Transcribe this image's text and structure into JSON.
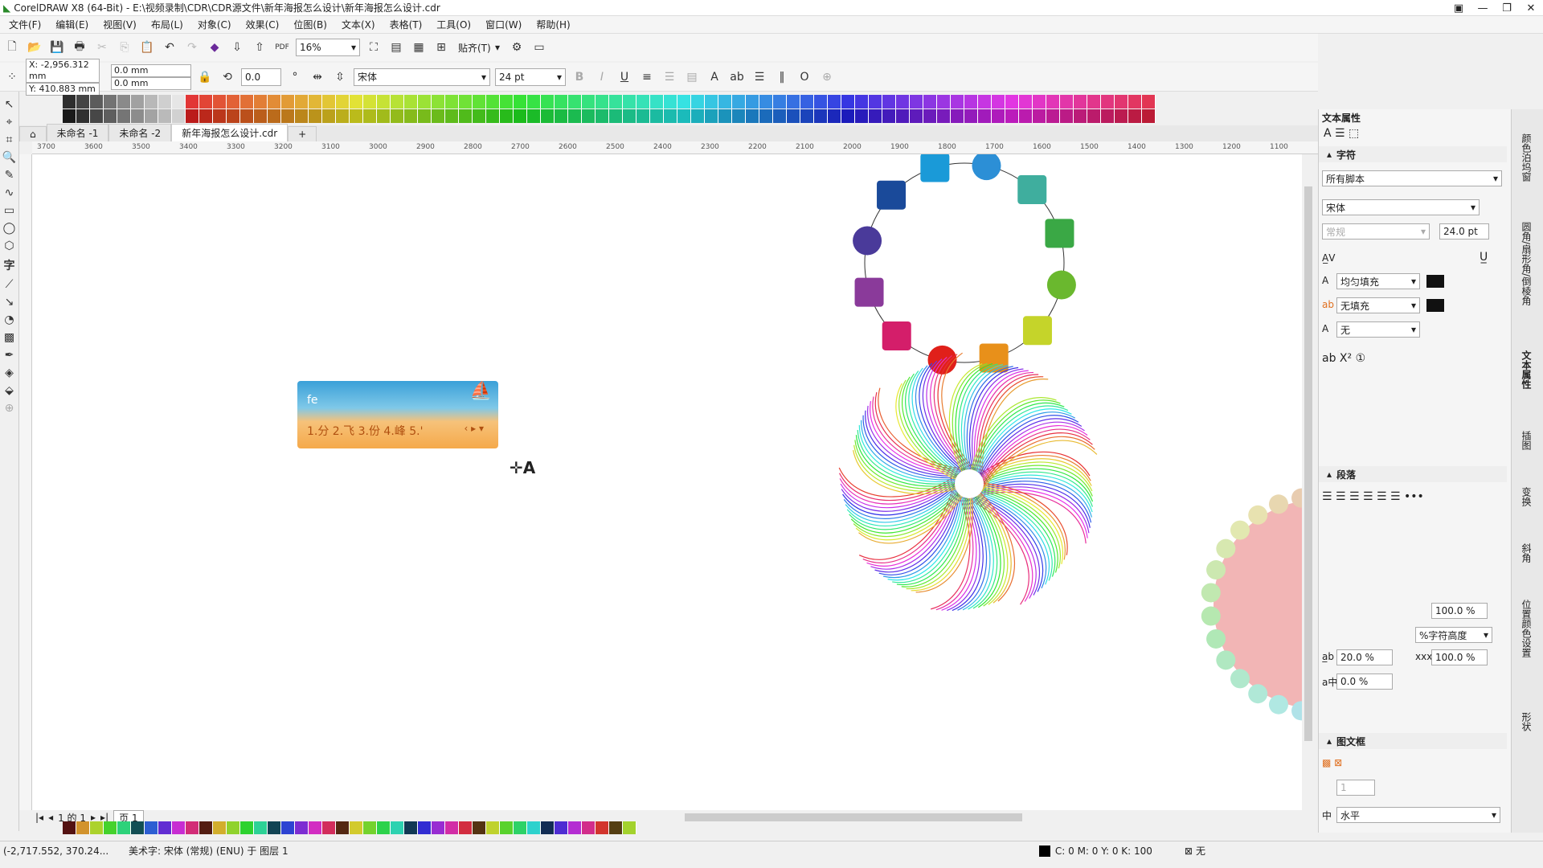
{
  "window": {
    "title": "CorelDRAW X8 (64-Bit) - E:\\视频录制\\CDR\\CDR源文件\\新年海报怎么设计\\新年海报怎么设计.cdr",
    "minimize": "—",
    "maximize": "❐",
    "close": "✕"
  },
  "menu": [
    "文件(F)",
    "编辑(E)",
    "视图(V)",
    "布局(L)",
    "对象(C)",
    "效果(C)",
    "位图(B)",
    "文本(X)",
    "表格(T)",
    "工具(O)",
    "窗口(W)",
    "帮助(H)"
  ],
  "toolbar": {
    "zoom": "16%",
    "snap_label": "贴齐(T)"
  },
  "propbar": {
    "x": "X: -2,956.312 mm",
    "y": "Y: 410.883 mm",
    "w": "0.0 mm",
    "h": "0.0 mm",
    "angle": "0.0",
    "font": "宋体",
    "size": "24 pt"
  },
  "tabs": [
    "未命名 -1",
    "未命名 -2",
    "新年海报怎么设计.cdr"
  ],
  "tab_add": "+",
  "ruler_ticks": [
    "3700",
    "3600",
    "3500",
    "3400",
    "3300",
    "3200",
    "3100",
    "3000",
    "2900",
    "2800",
    "2700",
    "2600",
    "2500",
    "2400",
    "2300",
    "2200",
    "2100",
    "2000",
    "1900",
    "1800",
    "1700",
    "1600",
    "1500",
    "1400",
    "1300",
    "1200",
    "1100"
  ],
  "ime": {
    "input": "fe",
    "candidates": "1.分  2.飞  3.份  4.峰  5.'"
  },
  "pagenav": {
    "page_count": "1 的 1",
    "page_label": "页 1"
  },
  "status": {
    "coords": "(-2,717.552, 370.24...",
    "object": "美术字: 宋体 (常规) (ENU) 于 图层 1",
    "fill": "C: 0 M: 0 Y: 0 K: 100",
    "outline": "无"
  },
  "panel": {
    "title": "文本属性",
    "char_section": "字符",
    "script": "所有脚本",
    "font": "宋体",
    "style": "常规",
    "size": "24.0 pt",
    "fill_type": "均匀填充",
    "bg_fill": "无填充",
    "outline": "无",
    "para_section": "段落",
    "line_spacing": "100.0 %",
    "spacing_unit": "%字符高度",
    "char_spacing": "20.0 %",
    "word_spacing": "100.0 %",
    "lang_spacing": "0.0 %",
    "frame_section": "图文框",
    "columns": "1",
    "direction": "水平"
  },
  "side_tabs": [
    "颜色泊坞窗",
    "圆角/扇形角/倒棱角",
    "文本属性",
    "插图",
    "变换",
    "斜角",
    "位置颜色设置",
    "形状"
  ],
  "colors": {
    "ime_top": "#3aa0d8",
    "ime_bottom": "#f5a94a",
    "pink_shape": "#f2b5b5"
  }
}
